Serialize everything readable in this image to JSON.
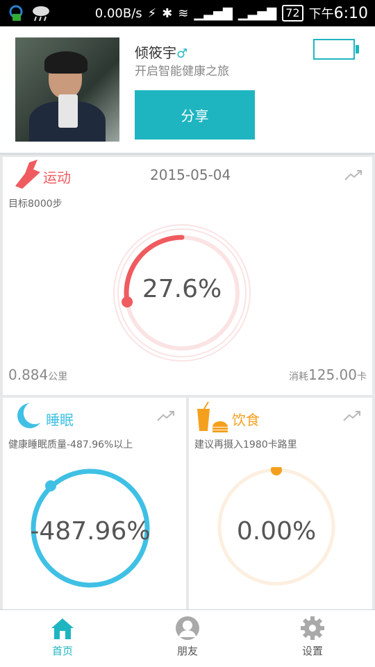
{
  "status_bar": {
    "net_speed": "0.00B/s",
    "battery_level": "72",
    "time_prefix": "下午",
    "time": "6:10"
  },
  "profile": {
    "name": "倾筱宇",
    "gender_symbol": "♂",
    "slogan": "开启智能健康之旅",
    "share_label": "分享"
  },
  "sport": {
    "title": "运动",
    "date": "2015-05-04",
    "goal": "目标8000步",
    "percent_text": "27.6%",
    "progress": 0.276,
    "distance_value": "0.884",
    "distance_unit": "公里",
    "calorie_label": "消耗",
    "calorie_value": "125.00",
    "calorie_unit": "卡",
    "color": "#ef5b5f"
  },
  "sleep": {
    "title": "睡眠",
    "subtitle": "健康睡眠质量-487.96%以上",
    "percent_text": "-487.96%",
    "color": "#3fc0e4"
  },
  "food": {
    "title": "饮食",
    "subtitle": "建议再摄入1980卡路里",
    "percent_text": "0.00%",
    "progress": 0,
    "color": "#f4a01e"
  },
  "nav": {
    "items": [
      {
        "label": "首页",
        "active": true
      },
      {
        "label": "朋友",
        "active": false
      },
      {
        "label": "设置",
        "active": false
      }
    ],
    "active_color": "#1eb5c1"
  }
}
